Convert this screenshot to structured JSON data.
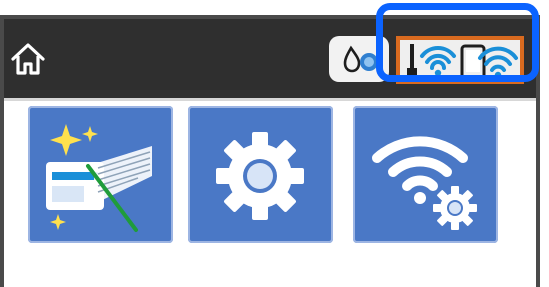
{
  "status_bar": {
    "home_icon": "home-icon",
    "ink_icon": "ink-drop-icon",
    "network_status_icons": [
      "wifi-router-icon",
      "wifi-direct-phone-icon"
    ],
    "highlight_color": "#0b63ff",
    "network_frame_color": "#d96a1f"
  },
  "menu_tiles": [
    {
      "icon": "print-head-maintenance-icon"
    },
    {
      "icon": "settings-gear-icon"
    },
    {
      "icon": "wifi-settings-icon"
    }
  ],
  "colors": {
    "status_bar_bg": "#2f2f2f",
    "tile_bg": "#4a78c6",
    "wifi_blue": "#1a8fd8"
  }
}
